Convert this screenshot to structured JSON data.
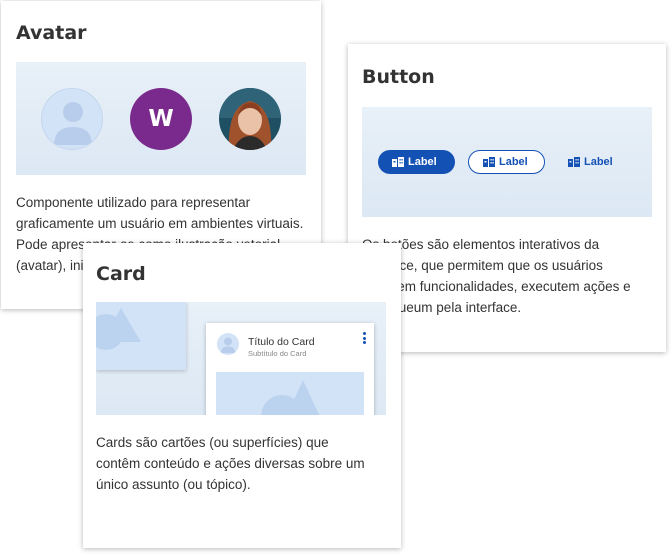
{
  "avatar": {
    "title": "Avatar",
    "letter": "W",
    "description": "Componente utilizado para representar graficamente um usuário em ambientes virtuais. Pode apresentar-se como ilustração vetorial (avatar), iniciais de nome ou fotografia (foto)."
  },
  "button": {
    "title": "Button",
    "labels": [
      "Label",
      "Label",
      "Label"
    ],
    "description": "Os botões são elementos interativos da interface, que permitem que os usuários acessem funcionalidades, executem ações e navegueum pela interface."
  },
  "card": {
    "title": "Card",
    "mini_title": "Título do Card",
    "mini_subtitle": "Subtítulo do Card",
    "description": "Cards são cartões (ou superfícies) que contêm conteúdo e ações diversas sobre um único assunto (ou tópico)."
  },
  "colors": {
    "primary": "#1351b4",
    "letter_avatar": "#7a2a8c",
    "placeholder": "#d3e3f7",
    "preview_bg": "#e1ebf6"
  },
  "icons": [
    "person-silhouette-icon",
    "building-icon",
    "kebab-menu-icon",
    "image-placeholder-icon"
  ]
}
